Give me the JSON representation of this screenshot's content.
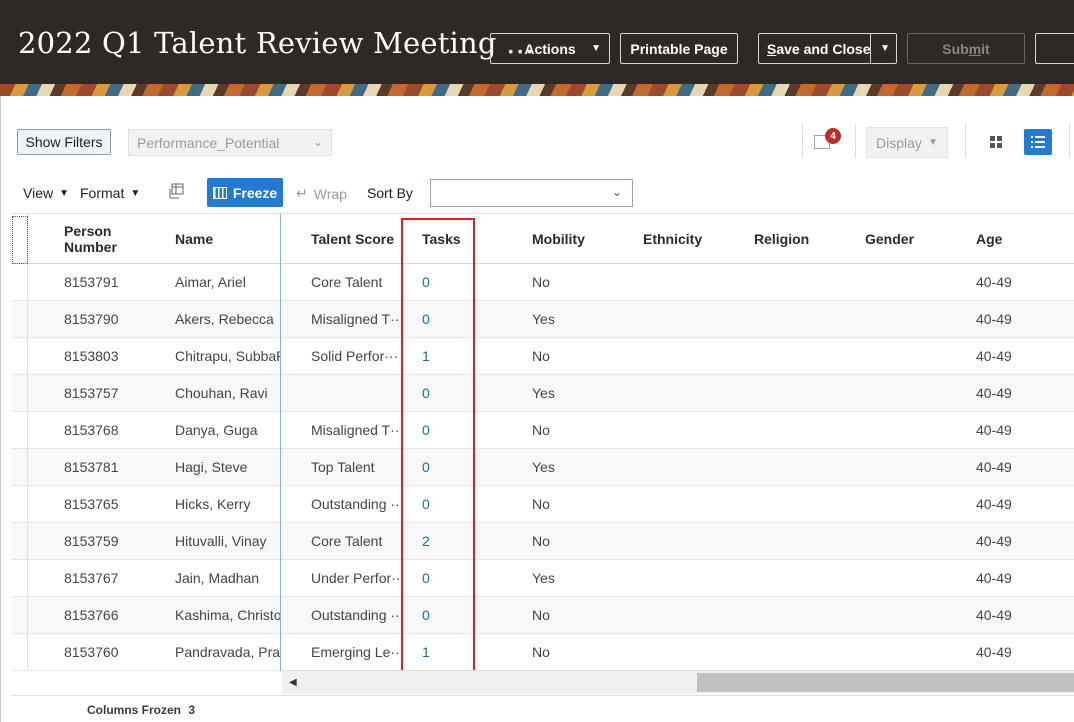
{
  "header": {
    "title": "2022 Q1 Talent Review Meeting ...",
    "actions_label": "Actions",
    "printable_label": "Printable Page",
    "save_close_label": "Save and Close",
    "save_close_underline": "S",
    "save_close_rest": "ave and Close",
    "submit_label": "Submit",
    "submit_underline": "m",
    "submit_pre": "Sub",
    "submit_post": "it"
  },
  "filters": {
    "show_filters_label": "Show Filters",
    "layout_select_value": "Performance_Potential",
    "notification_count": "4",
    "display_label": "Display"
  },
  "table_toolbar": {
    "view_label": "View",
    "format_label": "Format",
    "freeze_label": "Freeze",
    "wrap_label": "Wrap",
    "sort_by_label": "Sort By",
    "sort_by_value": ""
  },
  "table": {
    "columns": [
      "Person Number",
      "Name",
      "Talent Score",
      "Tasks",
      "Mobility",
      "Ethnicity",
      "Religion",
      "Gender",
      "Age"
    ],
    "column_person_line1": "Person",
    "column_person_line2": "Number",
    "rows": [
      [
        "8153791",
        "Aimar, Ariel",
        "Core Talent",
        "0",
        "No",
        "",
        "",
        "",
        "40-49"
      ],
      [
        "8153790",
        "Akers, Rebecca",
        "Misaligned T···",
        "0",
        "Yes",
        "",
        "",
        "",
        "40-49"
      ],
      [
        "8153803",
        "Chitrapu, SubbaR",
        "Solid Perfor···",
        "1",
        "No",
        "",
        "",
        "",
        "40-49"
      ],
      [
        "8153757",
        "Chouhan, Ravi",
        "",
        "0",
        "Yes",
        "",
        "",
        "",
        "40-49"
      ],
      [
        "8153768",
        "Danya, Guga",
        "Misaligned T···",
        "0",
        "No",
        "",
        "",
        "",
        "40-49"
      ],
      [
        "8153781",
        "Hagi, Steve",
        "Top Talent",
        "0",
        "Yes",
        "",
        "",
        "",
        "40-49"
      ],
      [
        "8153765",
        "Hicks, Kerry",
        "Outstanding ···",
        "0",
        "No",
        "",
        "",
        "",
        "40-49"
      ],
      [
        "8153759",
        "Hituvalli, Vinay",
        "Core Talent",
        "2",
        "No",
        "",
        "",
        "",
        "40-49"
      ],
      [
        "8153767",
        "Jain, Madhan",
        "Under Perfor···",
        "0",
        "Yes",
        "",
        "",
        "",
        "40-49"
      ],
      [
        "8153766",
        "Kashima, Christo",
        "Outstanding ···",
        "0",
        "No",
        "",
        "",
        "",
        "40-49"
      ],
      [
        "8153760",
        "Pandravada, Pra",
        "Emerging Le···",
        "1",
        "No",
        "",
        "",
        "",
        "40-49"
      ]
    ]
  },
  "footer": {
    "columns_frozen_label": "Columns Frozen",
    "columns_frozen_value": "3"
  },
  "colors": {
    "header_bg": "#2e2925",
    "accent": "#227bd1",
    "highlight": "#e02020",
    "task_link": "#1a6f9c"
  }
}
